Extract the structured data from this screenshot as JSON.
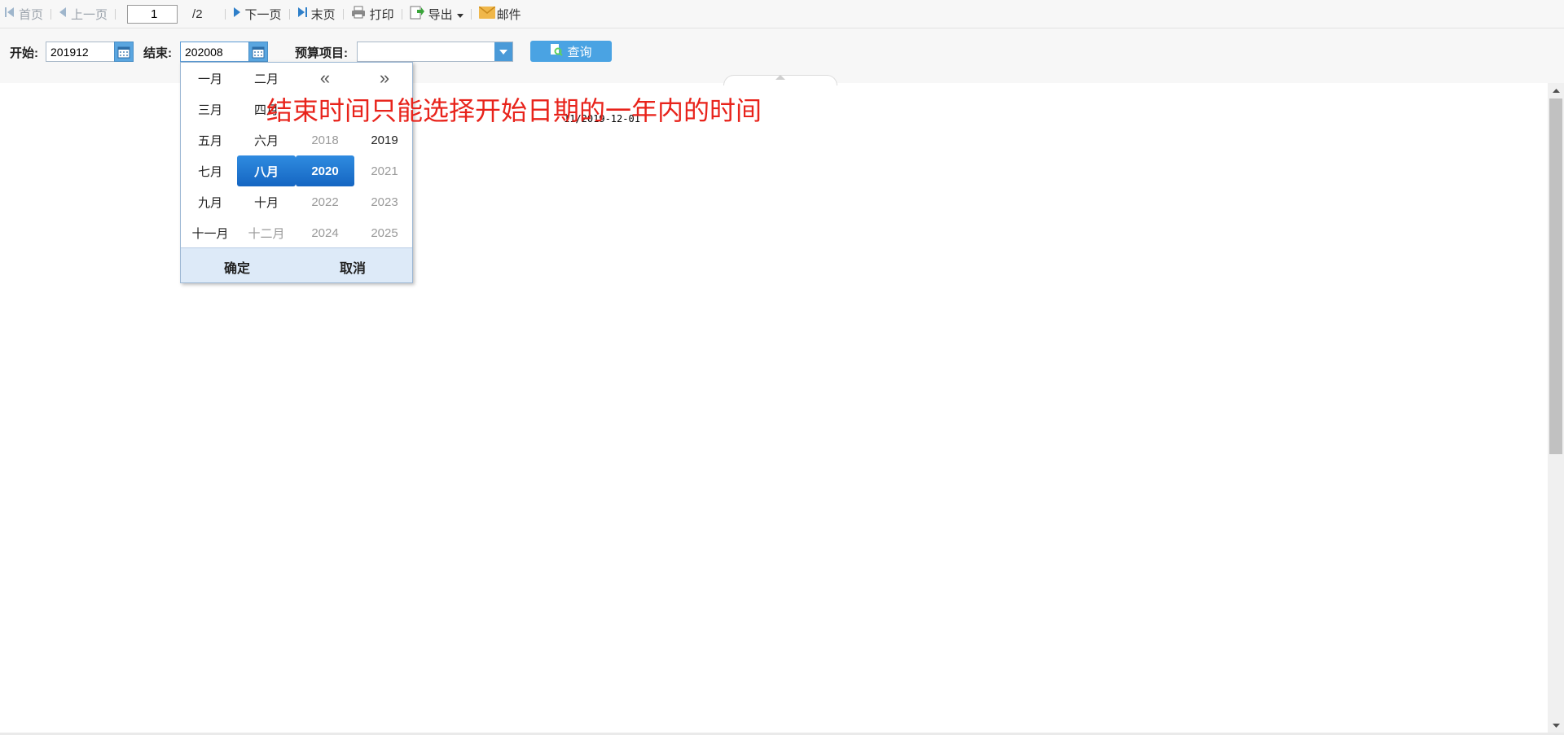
{
  "toolbar": {
    "first_label": "首页",
    "prev_label": "上一页",
    "page_value": "1",
    "page_total": "/2",
    "next_label": "下一页",
    "last_label": "末页",
    "print_label": "打印",
    "export_label": "导出",
    "mail_label": "邮件"
  },
  "filters": {
    "start_label": "开始:",
    "start_value": "201912",
    "end_label": "结束:",
    "end_value": "202008",
    "budget_label": "预算项目:",
    "budget_value": "",
    "query_label": "查询"
  },
  "report": {
    "text": "11/2019-12-01",
    "hidden_fragment": "四月"
  },
  "annotation": "结束时间只能选择开始日期的一年内的时间",
  "picker": {
    "months": [
      "一月",
      "二月",
      "三月",
      "四月",
      "五月",
      "六月",
      "七月",
      "八月",
      "九月",
      "十月",
      "十一月",
      "十二月"
    ],
    "selected_month": "八月",
    "prev_nav": "«",
    "next_nav": "»",
    "years": [
      "2018",
      "2019",
      "2020",
      "2021",
      "2022",
      "2023",
      "2024",
      "2025"
    ],
    "selected_year": "2020",
    "ok_label": "确定",
    "cancel_label": "取消"
  },
  "colors": {
    "accent": "#4aa3e3",
    "selected": "#1a72cf",
    "annotation": "#e8231b"
  }
}
